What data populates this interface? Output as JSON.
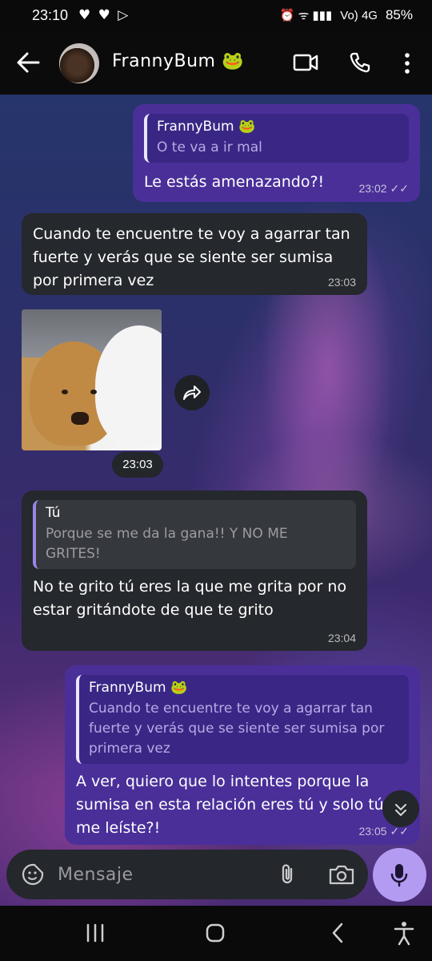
{
  "status_bar": {
    "time": "23:10",
    "left_icons": "♥ ♥ ▷",
    "right_icons": "⏰ ᯤ ▮▮▮",
    "network": "Vo) 4G",
    "battery": "85%"
  },
  "header": {
    "contact_name": "FrannyBum 🐸",
    "back_icon": "arrow-left",
    "video_icon": "video-camera",
    "call_icon": "phone",
    "more_icon": "more-vertical"
  },
  "messages": [
    {
      "direction": "outgoing",
      "quote_name": "FrannyBum 🐸",
      "quote_text": "O te va a ir mal",
      "text": "Le estás amenazando?!",
      "time": "23:02",
      "status": "read"
    },
    {
      "direction": "incoming",
      "text": "Cuando te encuentre te voy a agarrar tan fuerte y verás que se siente ser sumisa por primera vez",
      "time": "23:03"
    },
    {
      "direction": "incoming",
      "type": "image",
      "time": "23:03",
      "forward_icon": "forward-arrow"
    },
    {
      "direction": "incoming",
      "quote_name": "Tú",
      "quote_text": "Porque se me da la gana!! Y NO ME GRITES!",
      "text": "No te grito tú eres la que me grita por no estar gritándote de que te grito",
      "time": "23:04"
    },
    {
      "direction": "outgoing",
      "quote_name": "FrannyBum 🐸",
      "quote_text": "Cuando te encuentre te voy a agarrar tan fuerte y verás que se siente ser sumisa por primera vez",
      "text": "A ver, quiero que lo intentes porque la sumisa en esta relación eres tú y solo tú, me leíste?!",
      "time": "23:05",
      "status": "read"
    }
  ],
  "composer": {
    "placeholder": "Mensaje",
    "emoji_icon": "sticker-emoji",
    "attach_icon": "paperclip",
    "camera_icon": "camera",
    "mic_icon": "microphone"
  },
  "colors": {
    "outgoing_bubble": "#4a2f99",
    "incoming_bubble": "#25282c",
    "mic_button": "#b39bf2"
  }
}
